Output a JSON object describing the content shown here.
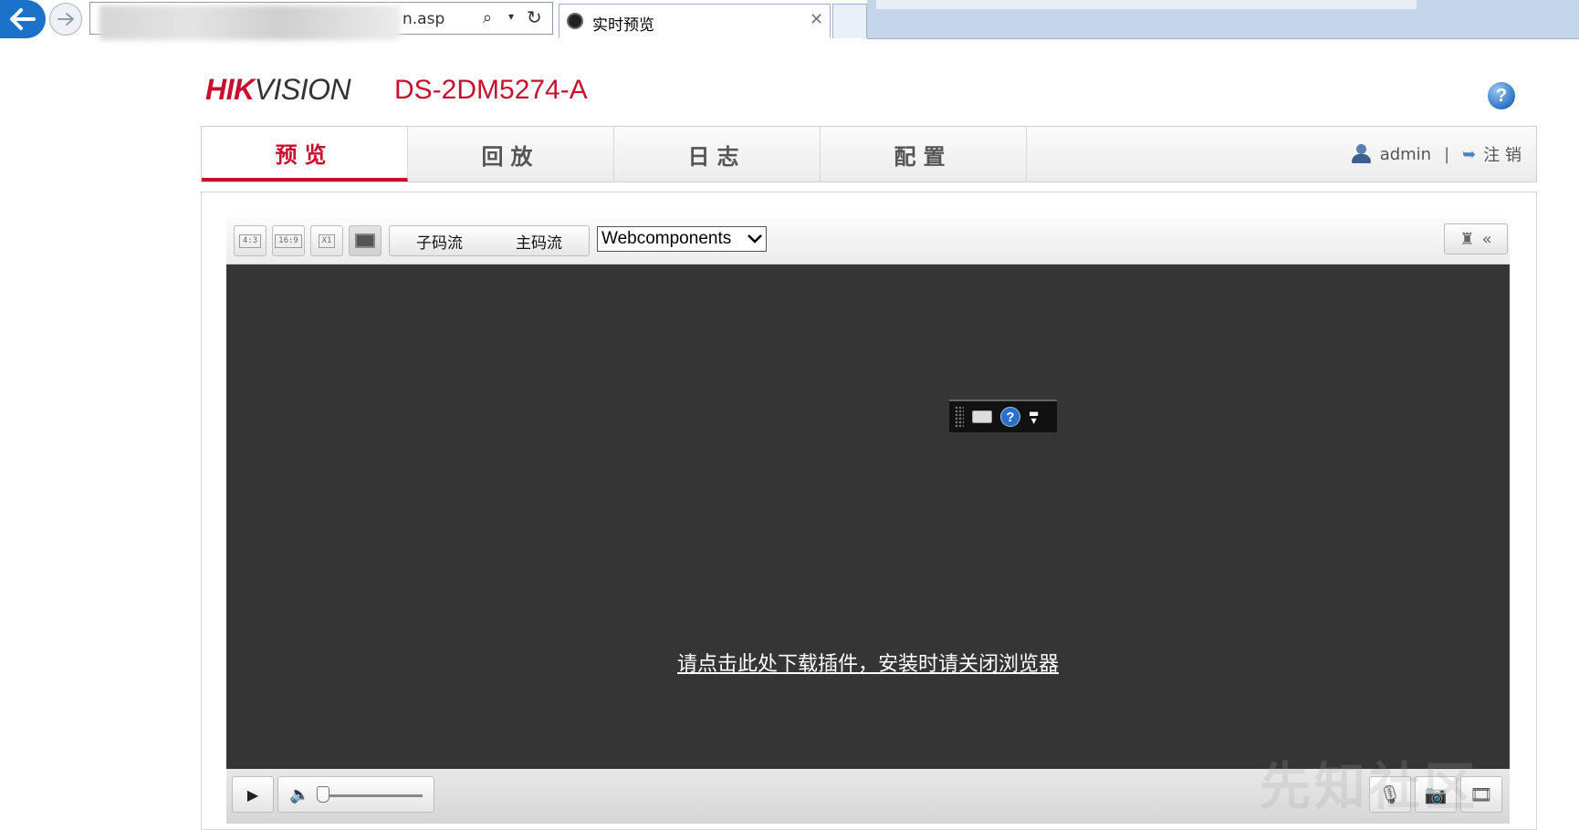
{
  "browser": {
    "address_suffix": "n.asp",
    "tab_title": "实时预览",
    "tab_close": "✕"
  },
  "header": {
    "logo_hik": "HIK",
    "logo_vision": "VISION",
    "model": "DS-2DM5274-A",
    "help": "?"
  },
  "nav": {
    "tabs": [
      {
        "label": "预览"
      },
      {
        "label": "回放"
      },
      {
        "label": "日志"
      },
      {
        "label": "配置"
      }
    ],
    "user": "admin",
    "separator": "|",
    "logout": "注 销"
  },
  "toolbar": {
    "ratio_4_3": "4:3",
    "ratio_16_9": "16:9",
    "ratio_x1": "X1",
    "sub_stream": "子码流",
    "main_stream": "主码流",
    "plugin_select": "Webcomponents"
  },
  "video": {
    "download_text": "请点击此处下载插件，安装时请关闭浏览器"
  },
  "watermark": "先知社区",
  "icons": {
    "back": "arrow-left-icon",
    "forward": "arrow-right-icon",
    "search": "search-icon",
    "refresh": "refresh-icon",
    "help": "help-icon",
    "user": "user-icon",
    "logout": "logout-icon",
    "ptz": "ptz-icon",
    "play": "play-icon",
    "volume": "volume-icon",
    "microphone": "microphone-icon",
    "capture": "camera-icon",
    "clip": "clip-icon"
  },
  "colors": {
    "brand_red": "#c8102e",
    "video_bg": "#353535"
  }
}
